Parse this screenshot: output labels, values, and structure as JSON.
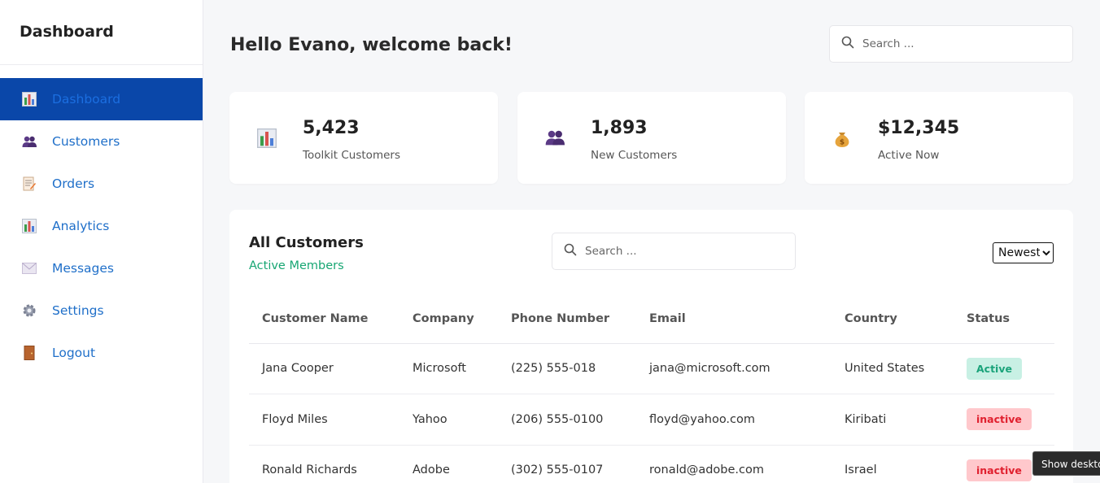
{
  "sidebar": {
    "title": "Dashboard",
    "items": [
      {
        "label": "Dashboard",
        "icon": "bar-chart-icon"
      },
      {
        "label": "Customers",
        "icon": "people-icon"
      },
      {
        "label": "Orders",
        "icon": "memo-icon"
      },
      {
        "label": "Analytics",
        "icon": "bar-chart-icon"
      },
      {
        "label": "Messages",
        "icon": "envelope-icon"
      },
      {
        "label": "Settings",
        "icon": "gear-icon"
      },
      {
        "label": "Logout",
        "icon": "door-icon"
      }
    ]
  },
  "header": {
    "greeting": "Hello Evano, welcome back!",
    "search_placeholder": "Search ..."
  },
  "stats": [
    {
      "value": "5,423",
      "label": "Toolkit Customers",
      "icon": "bar-chart-icon"
    },
    {
      "value": "1,893",
      "label": "New Customers",
      "icon": "people-icon"
    },
    {
      "value": "$12,345",
      "label": "Active Now",
      "icon": "money-bag-icon"
    }
  ],
  "customers": {
    "title": "All Customers",
    "subtitle": "Active Members",
    "search_placeholder": "Search ...",
    "sort_selected": "Newest",
    "columns": [
      "Customer Name",
      "Company",
      "Phone Number",
      "Email",
      "Country",
      "Status"
    ],
    "rows": [
      {
        "name": "Jana Cooper",
        "company": "Microsoft",
        "phone": "(225) 555-018",
        "email": "jana@microsoft.com",
        "country": "United States",
        "status": "Active"
      },
      {
        "name": "Floyd Miles",
        "company": "Yahoo",
        "phone": "(206) 555-0100",
        "email": "floyd@yahoo.com",
        "country": "Kiribati",
        "status": "inactive"
      },
      {
        "name": "Ronald Richards",
        "company": "Adobe",
        "phone": "(302) 555-0107",
        "email": "ronald@adobe.com",
        "country": "Israel",
        "status": "inactive"
      }
    ]
  },
  "tooltip": "Show desktop",
  "colors": {
    "active_nav_bg": "#0a47a9",
    "link": "#1f6fc9",
    "accent_green": "#17a673",
    "active_badge_bg": "#c8f0e4",
    "inactive_badge_bg": "#ffc8cc"
  }
}
